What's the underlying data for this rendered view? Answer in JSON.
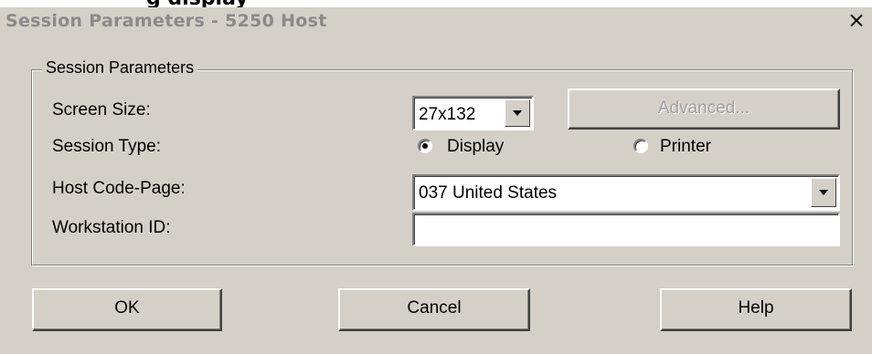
{
  "window": {
    "title": "Session Parameters - 5250 Host",
    "close_glyph": "×",
    "cropped_text_above": "g display"
  },
  "group": {
    "legend": "Session Parameters"
  },
  "fields": {
    "screen_size": {
      "label": "Screen Size:",
      "value": "27x132"
    },
    "session_type": {
      "label": "Session Type:",
      "options": [
        {
          "label": "Display",
          "selected": true
        },
        {
          "label": "Printer",
          "selected": false
        }
      ]
    },
    "host_code_page": {
      "label": "Host Code-Page:",
      "value": "037 United States"
    },
    "workstation_id": {
      "label": "Workstation ID:",
      "value": ""
    }
  },
  "buttons": {
    "advanced": "Advanced...",
    "ok": "OK",
    "cancel": "Cancel",
    "help": "Help"
  },
  "icons": {
    "dropdown": "chevron-down-icon",
    "close": "close-icon"
  },
  "colors": {
    "dialog_bg": "#d4d0c8",
    "title_text": "#8a8a8a",
    "disabled_text": "#a0a0a0"
  }
}
